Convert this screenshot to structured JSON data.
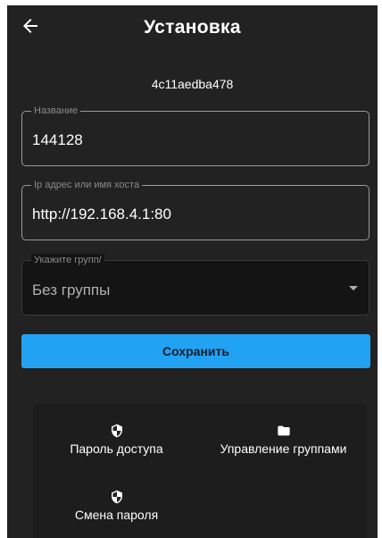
{
  "header": {
    "title": "Установка"
  },
  "device_id": "4c11aedba478",
  "fields": {
    "name": {
      "label": "Название",
      "value": "144128"
    },
    "host": {
      "label": "Ip адрес или имя хоста",
      "value": "http://192.168.4.1:80"
    },
    "group": {
      "label": "Укажите групп/",
      "value": "Без группы"
    }
  },
  "save_label": "Сохранить",
  "actions": {
    "access_password": {
      "label": "Пароль доступа",
      "icon": "shield-icon"
    },
    "manage_groups": {
      "label": "Управление группами",
      "icon": "folder-icon"
    },
    "change_password": {
      "label": "Смена пароля",
      "icon": "shield-icon"
    }
  },
  "colors": {
    "background": "#222222",
    "accent": "#22a2f2",
    "text": "#ffffff"
  }
}
